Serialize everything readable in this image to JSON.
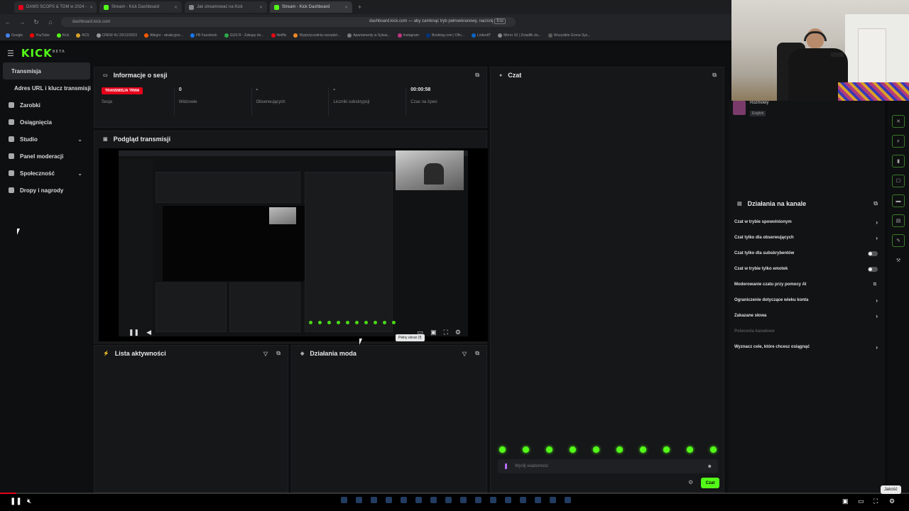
{
  "browser": {
    "tabs": [
      {
        "label": "DAMS SCOPS & TOM w 2024 -",
        "color": "#e5001a",
        "active": false
      },
      {
        "label": "Stream - Kick Dashboard",
        "color": "#53fc18",
        "active": false
      },
      {
        "label": "Jak streamować na Kick",
        "color": "#888888",
        "active": false
      },
      {
        "label": "Stream - Kick Dashboard",
        "color": "#53fc18",
        "active": true
      }
    ],
    "new_tab": "+",
    "url": "dashboard.kick.com",
    "fullscreen_note": "dashboard.kick.com — aby zamknąć tryb pełnoekranowy, naciśnij",
    "fullscreen_key": "Esc",
    "bookmarks": [
      "Google",
      "YouTube",
      "Kick",
      "ACS",
      "CREW 4U 20/12/2023",
      "Allegro - atrakcyjne...",
      "FB Facebook",
      "GUS R - Zakupy do...",
      "Netflix",
      "Wypożyczalnia narzędzi...",
      "Apartamenty w Sytwa...",
      "Instagram",
      "Booking.com | Ofic...",
      "LinkedIT",
      "Mirror 10 | Zrzędlik do...",
      "Wszystkie Grona Sys..."
    ]
  },
  "app": {
    "logo": "KICK",
    "logo_sup": "BETA",
    "sidebar": [
      {
        "label": "Transmisja",
        "active": true,
        "sub": false
      },
      {
        "label": "Adres URL i klucz transmisji",
        "active": false,
        "sub": true
      },
      {
        "label": "Zarobki",
        "active": false,
        "sub": false
      },
      {
        "label": "Osiągnięcia",
        "active": false,
        "sub": false
      },
      {
        "label": "Studio",
        "active": false,
        "sub": false,
        "chevron": true
      },
      {
        "label": "Panel moderacji",
        "active": false,
        "sub": false
      },
      {
        "label": "Społeczność",
        "active": false,
        "sub": false,
        "chevron": true
      },
      {
        "label": "Dropy i nagrody",
        "active": false,
        "sub": false
      }
    ],
    "session": {
      "title": "Informacje o sesji",
      "cells": [
        {
          "value_badge": "TRANSMISJA TRWA",
          "label": "Sesja"
        },
        {
          "value": "0",
          "label": "Widzowie"
        },
        {
          "value": "-",
          "label": "Obserwujących"
        },
        {
          "value": "-",
          "label": "Liczniki subskrypcji"
        },
        {
          "value": "00:00:58",
          "label": "Czas na żywo"
        }
      ]
    },
    "preview": {
      "title": "Podgląd transmisji",
      "tooltip": "Pełny ekran (f)"
    },
    "activity": {
      "title": "Lista aktywności"
    },
    "mod": {
      "title": "Działania moda"
    },
    "chat": {
      "title": "Czat",
      "placeholder": "Wyślij wiadomość",
      "send": "Czat"
    },
    "user": {
      "name": "Rozmowy",
      "badge": "English"
    },
    "channel": {
      "title": "Działania na kanale",
      "rows": [
        {
          "label": "Czat w trybie spowolnionym",
          "control": "arrow"
        },
        {
          "label": "Czat tylko dla obserwujących",
          "control": "arrow"
        },
        {
          "label": "Czat tylko dla subskrybentów",
          "control": "toggle"
        },
        {
          "label": "Czat w trybie tylko emotek",
          "control": "toggle"
        },
        {
          "label": "Moderowanie czatu przy pomocy AI",
          "control": "small"
        },
        {
          "label": "Ograniczenie dotyczące wieku konta",
          "control": "arrow"
        },
        {
          "label": "Zakazane słowa",
          "control": "arrow"
        },
        {
          "label": "Polecenia kanałowe",
          "control": "none",
          "dim": true
        },
        {
          "label": "Wyznacz cele, które chcesz osiągnąć",
          "control": "arrow"
        }
      ]
    }
  },
  "player": {
    "quality_label": "Jakość",
    "progress": 0.018
  },
  "colors": {
    "accent": "#53fc18",
    "live": "#e5001a"
  }
}
